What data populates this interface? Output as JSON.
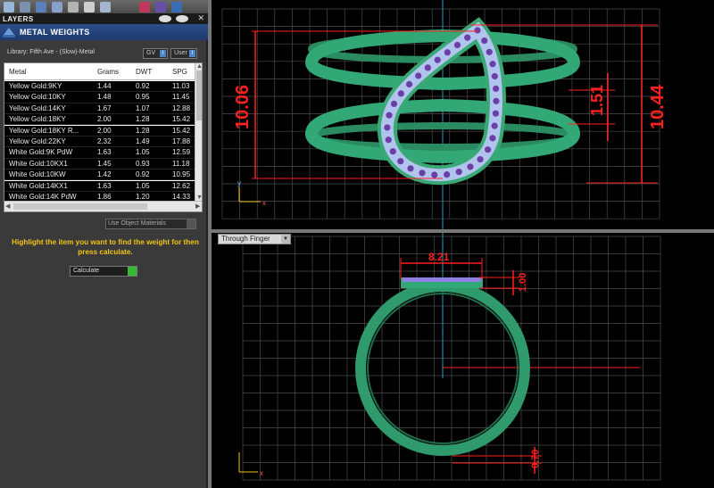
{
  "panel": {
    "layers_title": "LAYERS",
    "metal_weights_title": "METAL WEIGHTS",
    "library_text": "Library: Fifth Ave - (Slow)-Metal",
    "gv_label": "GV",
    "user_label": "User",
    "indicator_text": "I",
    "use_object_materials_label": "Use Object Materials",
    "instruction_text": "Highlight the item you want to find the weight for then press calculate.",
    "calculate_label": "Calculate",
    "table": {
      "headers": [
        "Metal",
        "Grams",
        "DWT",
        "SPG"
      ],
      "rows": [
        [
          "Yellow Gold:9KY",
          "1.44",
          "0.92",
          "11.03"
        ],
        [
          "Yellow Gold:10KY",
          "1.48",
          "0.95",
          "11.45"
        ],
        [
          "Yellow Gold:14KY",
          "1.67",
          "1.07",
          "12.88"
        ],
        [
          "Yellow Gold:18KY",
          "2.00",
          "1.28",
          "15.42"
        ],
        [
          "Yellow Gold:18KY R...",
          "2.00",
          "1.28",
          "15.42"
        ],
        [
          "Yellow Gold:22KY",
          "2.32",
          "1.49",
          "17.88"
        ],
        [
          "White Gold:9K PdW",
          "1.63",
          "1.05",
          "12.59"
        ],
        [
          "White Gold:10KX1",
          "1.45",
          "0.93",
          "11.18"
        ],
        [
          "White Gold:10KW",
          "1.42",
          "0.92",
          "10.95"
        ],
        [
          "White Gold:14KX1",
          "1.63",
          "1.05",
          "12.62"
        ],
        [
          "White Gold:14K PdW",
          "1.86",
          "1.20",
          "14.33"
        ]
      ]
    }
  },
  "viewports": {
    "bottom_label": "Through Finger",
    "top_dimensions": {
      "height_left": "10.06",
      "height_right": "10.44",
      "gap": "1.51"
    },
    "bottom_dimensions": {
      "width": "8.21",
      "setting_height": "1.00",
      "shank_thickness": "0.70"
    },
    "axis_x": "x",
    "axis_y": "y"
  },
  "colors": {
    "ring_green": "#2f9a6c",
    "stone_blue": "#b0c4ee",
    "bead_purple": "#6a3fa6",
    "dimension_red": "#ff2020",
    "grid": "#4d4d4d",
    "highlight_yellow": "#f2c316",
    "header_blue": "#2b4f8a"
  }
}
